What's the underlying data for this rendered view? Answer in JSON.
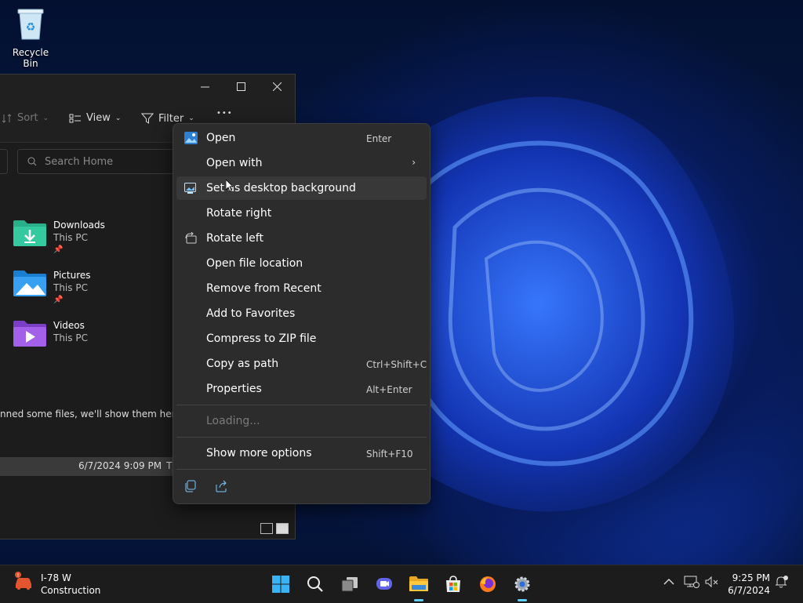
{
  "desktop": {
    "recycle_bin_label": "Recycle Bin"
  },
  "explorer": {
    "toolbar": {
      "sort": "Sort",
      "view": "View",
      "filter": "Filter",
      "more": "•••"
    },
    "search_placeholder": "Search Home",
    "quick_access": [
      {
        "name": "Downloads",
        "location": "This PC"
      },
      {
        "name": "Pictures",
        "location": "This PC"
      },
      {
        "name": "Videos",
        "location": "This PC"
      }
    ],
    "recent_message": "nned some files, we'll show them here.",
    "recent_row": {
      "date": "6/7/2024 9:09 PM",
      "type": "T"
    }
  },
  "context_menu": {
    "items": [
      {
        "label": "Open",
        "shortcut": "Enter"
      },
      {
        "label": "Open with"
      },
      {
        "label": "Set as desktop background"
      },
      {
        "label": "Rotate right"
      },
      {
        "label": "Rotate left"
      },
      {
        "label": "Open file location"
      },
      {
        "label": "Remove from Recent"
      },
      {
        "label": "Add to Favorites"
      },
      {
        "label": "Compress to ZIP file"
      },
      {
        "label": "Copy as path",
        "shortcut": "Ctrl+Shift+C"
      },
      {
        "label": "Properties",
        "shortcut": "Alt+Enter"
      }
    ],
    "loading": "Loading...",
    "show_more": {
      "label": "Show more options",
      "shortcut": "Shift+F10"
    }
  },
  "taskbar": {
    "weather": {
      "line1": "I-78 W",
      "line2": "Construction"
    },
    "clock": {
      "time": "9:25 PM",
      "date": "6/7/2024"
    }
  },
  "colors": {
    "accent": "#60cdff",
    "menu_bg": "#2c2c2c",
    "taskbar_bg": "#1c1c1c"
  }
}
